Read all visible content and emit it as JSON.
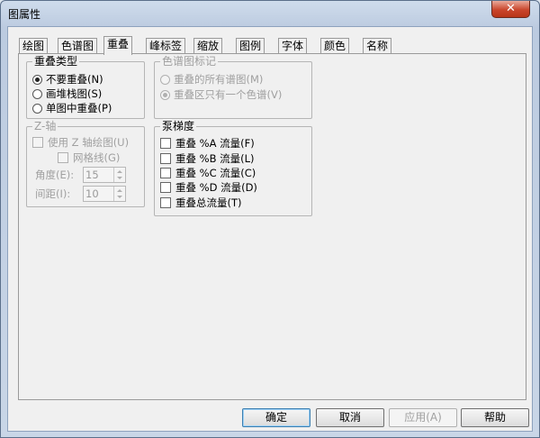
{
  "window": {
    "title": "图属性",
    "close_glyph": "✕"
  },
  "tabs": [
    {
      "label": "绘图",
      "active": false
    },
    {
      "label": "色谱图",
      "active": false
    },
    {
      "label": "重叠",
      "active": true
    },
    {
      "label": "峰标签",
      "active": false
    },
    {
      "label": "缩放",
      "active": false
    },
    {
      "label": "图例",
      "active": false
    },
    {
      "label": "字体",
      "active": false
    },
    {
      "label": "颜色",
      "active": false
    },
    {
      "label": "名称",
      "active": false
    }
  ],
  "overlay_type": {
    "title": "重叠类型",
    "options": [
      {
        "label": "不要重叠(N)",
        "selected": true
      },
      {
        "label": "画堆栈图(S)",
        "selected": false
      },
      {
        "label": "单图中重叠(P)",
        "selected": false
      }
    ]
  },
  "chrom_label": {
    "title": "色谱图标记",
    "options": [
      {
        "label": "重叠的所有谱图(M)",
        "selected": false
      },
      {
        "label": "重叠区只有一个色谱(V)",
        "selected": true
      }
    ]
  },
  "z_axis": {
    "title": "Z-轴",
    "use_z": {
      "label": "使用 Z 轴绘图(U)",
      "checked": false
    },
    "grid": {
      "label": "网格线(G)",
      "checked": false
    },
    "angle": {
      "label": "角度(E):",
      "value": "15"
    },
    "spacing": {
      "label": "间距(I):",
      "value": "10"
    }
  },
  "pump_gradient": {
    "title": "泵梯度",
    "items": [
      {
        "label": "重叠 %A 流量(F)",
        "checked": false
      },
      {
        "label": "重叠 %B 流量(L)",
        "checked": false
      },
      {
        "label": "重叠 %C 流量(C)",
        "checked": false
      },
      {
        "label": "重叠 %D 流量(D)",
        "checked": false
      },
      {
        "label": "重叠总流量(T)",
        "checked": false
      }
    ]
  },
  "buttons": {
    "ok": "确定",
    "cancel": "取消",
    "apply": "应用(A)",
    "help": "帮助"
  }
}
